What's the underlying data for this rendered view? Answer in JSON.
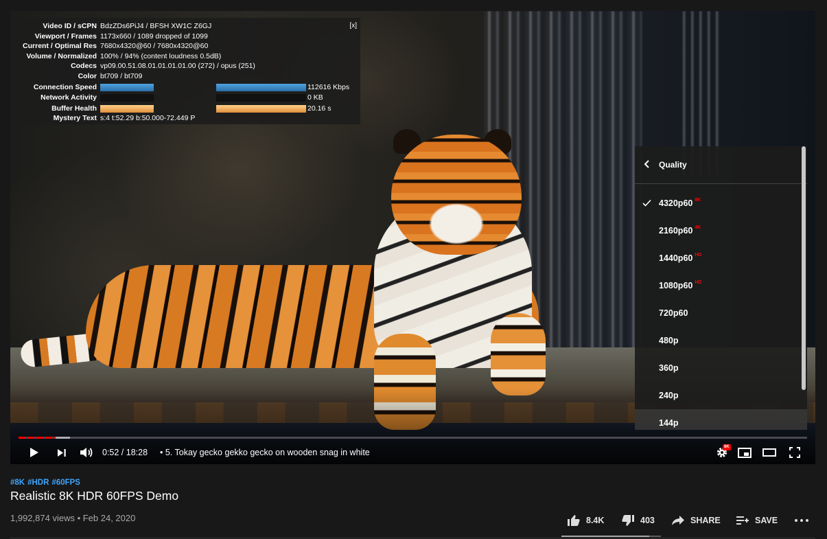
{
  "player": {
    "stats": {
      "close_label": "[x]",
      "rows": [
        {
          "key": "Video ID / sCPN",
          "value": "BdzZDs6PiJ4 / BFSH XW1C Z6GJ"
        },
        {
          "key": "Viewport / Frames",
          "value": "1173x660 / 1089 dropped of 1099"
        },
        {
          "key": "Current / Optimal Res",
          "value": "7680x4320@60 / 7680x4320@60"
        },
        {
          "key": "Volume / Normalized",
          "value": "100% / 94% (content loudness 0.5dB)"
        },
        {
          "key": "Codecs",
          "value": "vp09.00.51.08.01.01.01.01.00 (272) / opus (251)"
        },
        {
          "key": "Color",
          "value": "bt709 / bt709"
        }
      ],
      "graphs": [
        {
          "key": "Connection Speed",
          "value": "112616 Kbps"
        },
        {
          "key": "Network Activity",
          "value": "0 KB"
        },
        {
          "key": "Buffer Health",
          "value": "20.16 s"
        }
      ],
      "mystery": {
        "key": "Mystery Text",
        "value": "s:4 t:52.29 b:50.000-72.449 P"
      }
    },
    "quality_menu": {
      "title": "Quality",
      "options": [
        {
          "label": "4320p60",
          "badge": "8K",
          "selected": true
        },
        {
          "label": "2160p60",
          "badge": "4K",
          "selected": false
        },
        {
          "label": "1440p60",
          "badge": "HD",
          "selected": false
        },
        {
          "label": "1080p60",
          "badge": "HD",
          "selected": false
        },
        {
          "label": "720p60",
          "badge": "",
          "selected": false
        },
        {
          "label": "480p",
          "badge": "",
          "selected": false
        },
        {
          "label": "360p",
          "badge": "",
          "selected": false
        },
        {
          "label": "240p",
          "badge": "",
          "selected": false
        },
        {
          "label": "144p",
          "badge": "",
          "selected": false
        }
      ]
    },
    "controls": {
      "time": "0:52 / 18:28",
      "chapter": "5. Tokay gecko gekko gecko on wooden snag in white",
      "quality_badge": "8K"
    },
    "progress": {
      "played_fraction": 0.047,
      "buffered_fraction": 0.065
    }
  },
  "video": {
    "hashtags": [
      "#8K",
      "#HDR",
      "#60FPS"
    ],
    "title": "Realistic 8K HDR 60FPS Demo",
    "views": "1,992,874 views",
    "date": "Feb 24, 2020",
    "likes": "8.4K",
    "dislikes": "403",
    "share_label": "SHARE",
    "save_label": "SAVE"
  },
  "colors": {
    "accent": "#ff0000",
    "hashtag": "#3ea6ff",
    "background": "#181818"
  }
}
